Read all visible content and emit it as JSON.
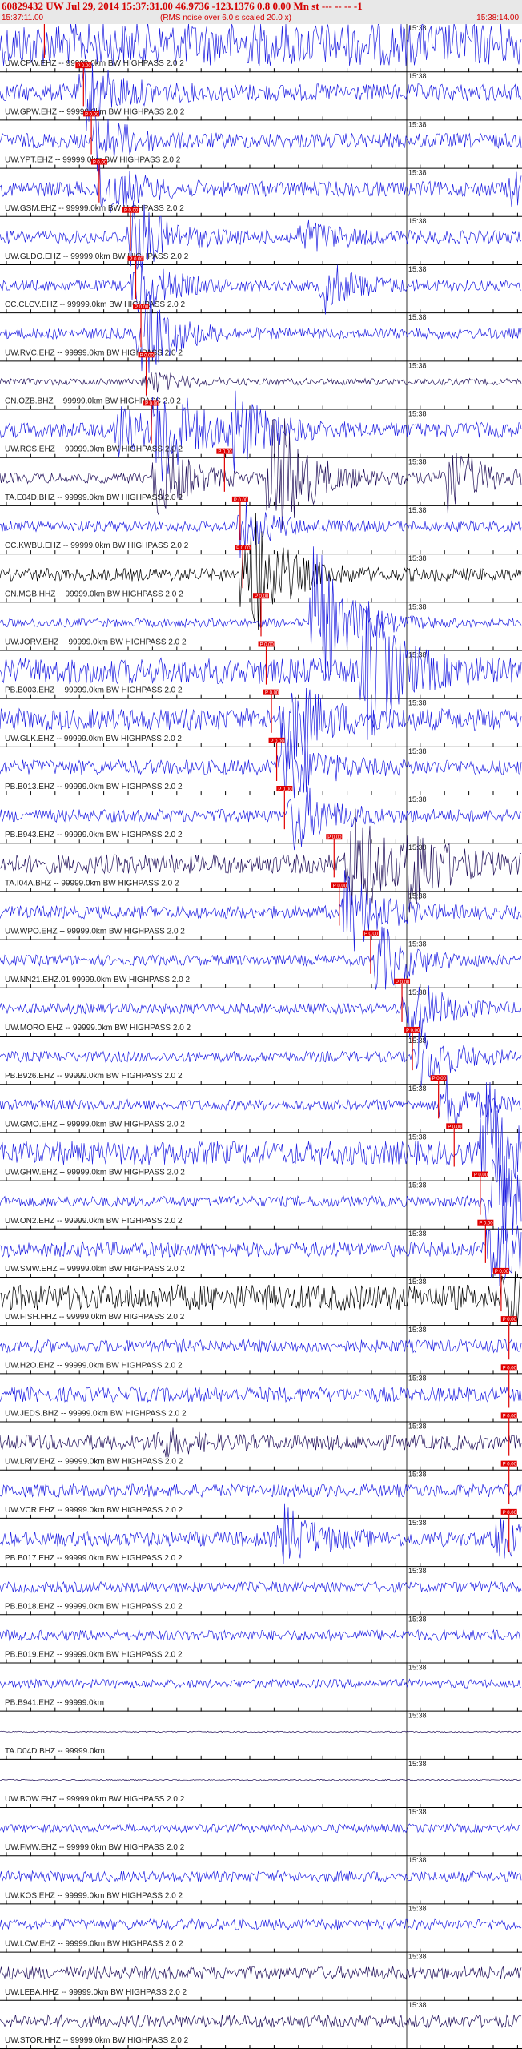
{
  "header": {
    "title": "60829432 UW Jul 29, 2014 15:37:31.00   46.9736 -123.1376  0.8 0.00 Mn st --- -- --  -1",
    "start_time": "15:37:11.00",
    "rms_note": "(RMS noise over 6.0 s scaled 20.0 x)",
    "end_time": "15:38:14.00"
  },
  "time_marker_label": "15:38",
  "pick_label": "P 0.00",
  "colors": {
    "trace_blue": "#1f1fe0",
    "trace_dark": "#22115a",
    "trace_black": "#000000",
    "pick_red": "#e00000",
    "header_red": "#d40000"
  },
  "traces": [
    {
      "label": "UW.CPW.EHZ -- 99999.0km BW  HIGHPASS  2.0  2",
      "color": "blue",
      "pick": 0.085,
      "amp": 1.0,
      "bursts": []
    },
    {
      "label": "UW.GPW.EHZ -- 99999.0km BW  HIGHPASS  2.0  2",
      "color": "blue",
      "pick": 0.16,
      "amp": 0.4,
      "bursts": [
        [
          0.16,
          1.6
        ]
      ]
    },
    {
      "label": "UW.YPT.EHZ -- 99999.0km BW  HIGHPASS  2.0  2",
      "color": "blue",
      "pick": 0.175,
      "amp": 0.35,
      "bursts": [
        [
          0.18,
          1.3
        ]
      ]
    },
    {
      "label": "UW.GSM.EHZ -- 99999.0km BW  HIGHPASS  2.0  2",
      "color": "blue",
      "pick": 0.19,
      "amp": 0.35,
      "bursts": [
        [
          0.19,
          1.5
        ],
        [
          0.98,
          0.6
        ]
      ]
    },
    {
      "label": "UW.GLDO.EHZ -- 99999.0km BW  HIGHPASS  2.0  2",
      "color": "blue",
      "pick": 0.25,
      "amp": 0.3,
      "bursts": [
        [
          0.25,
          2.0
        ],
        [
          0.58,
          0.8
        ]
      ]
    },
    {
      "label": "CC.CLCV.EHZ -- 99999.0km BW  HIGHPASS  2.0  2",
      "color": "blue",
      "pick": 0.26,
      "amp": 0.25,
      "bursts": [
        [
          0.26,
          1.5
        ],
        [
          0.62,
          1.2
        ]
      ]
    },
    {
      "label": "UW.RVC.EHZ -- 99999.0km BW  HIGHPASS  2.0  2",
      "color": "blue",
      "pick": 0.27,
      "amp": 0.25,
      "bursts": [
        [
          0.27,
          2.2
        ]
      ]
    },
    {
      "label": "CN.OZB.BHZ -- 99999.0km BW  HIGHPASS  2.0  2",
      "color": "dark",
      "pick": 0.28,
      "amp": 0.15,
      "bursts": [
        [
          0.28,
          0.6
        ]
      ]
    },
    {
      "label": "UW.RCS.EHZ -- 99999.0km BW  HIGHPASS  2.0  2",
      "color": "blue",
      "pick": 0.29,
      "amp": 0.35,
      "bursts": [
        [
          0.3,
          3.2
        ],
        [
          0.44,
          1.8
        ],
        [
          0.22,
          1.2
        ]
      ]
    },
    {
      "label": "TA.E04D.BHZ -- 99999.0km BW  HIGHPASS  2.0  2",
      "color": "dark",
      "pick": 0.43,
      "amp": 0.25,
      "bursts": [
        [
          0.3,
          2.0
        ],
        [
          0.52,
          4.0
        ],
        [
          0.85,
          2.0
        ]
      ]
    },
    {
      "label": "CC.KWBU.EHZ -- 99999.0km BW  HIGHPASS  2.0  2",
      "color": "blue",
      "pick": 0.46,
      "amp": 0.25,
      "bursts": [
        [
          0.46,
          1.2
        ]
      ]
    },
    {
      "label": "CN.MGB.HHZ -- 99999.0km BW  HIGHPASS  2.0  2",
      "color": "black",
      "pick": 0.465,
      "amp": 0.3,
      "bursts": [
        [
          0.47,
          4.0
        ]
      ]
    },
    {
      "label": "UW.JORV.EHZ -- 99999.0km BW  HIGHPASS  2.0  2",
      "color": "blue",
      "pick": 0.5,
      "amp": 0.2,
      "bursts": [
        [
          0.6,
          4.0
        ]
      ]
    },
    {
      "label": "PB.B003.EHZ -- 99999.0km BW  HIGHPASS  2.0  2",
      "color": "blue",
      "pick": 0.51,
      "amp": 0.6,
      "bursts": [
        [
          0.7,
          3.5
        ]
      ]
    },
    {
      "label": "UW.GLK.EHZ -- 99999.0km BW  HIGHPASS  2.0  2",
      "color": "blue",
      "pick": 0.52,
      "amp": 0.5,
      "bursts": [
        [
          0.54,
          2.5
        ]
      ]
    },
    {
      "label": "PB.B013.EHZ -- 99999.0km BW  HIGHPASS  2.0  2",
      "color": "blue",
      "pick": 0.53,
      "amp": 0.35,
      "bursts": [
        [
          0.54,
          2.0
        ]
      ]
    },
    {
      "label": "PB.B943.EHZ -- 99999.0km BW  HIGHPASS  2.0  2",
      "color": "blue",
      "pick": 0.545,
      "amp": 0.3,
      "bursts": [
        [
          0.56,
          1.8
        ]
      ]
    },
    {
      "label": "TA.I04A.BHZ -- 99999.0km BW  HIGHPASS  2.0  2",
      "color": "dark",
      "pick": 0.64,
      "amp": 0.45,
      "bursts": [
        [
          0.67,
          3.0
        ],
        [
          0.78,
          2.0
        ]
      ]
    },
    {
      "label": "UW.WPO.EHZ -- 99999.0km BW  HIGHPASS  2.0  2",
      "color": "blue",
      "pick": 0.65,
      "amp": 0.3,
      "bursts": [
        [
          0.66,
          2.2
        ]
      ]
    },
    {
      "label": "UW.NN21.EHZ.01 99999.0km BW  HIGHPASS  2.0  2",
      "color": "blue",
      "pick": 0.71,
      "amp": 0.25,
      "bursts": [
        [
          0.72,
          1.8
        ]
      ]
    },
    {
      "label": "UW.MORO.EHZ -- 99999.0km BW  HIGHPASS  2.0  2",
      "color": "blue",
      "pick": 0.77,
      "amp": 0.25,
      "bursts": [
        [
          0.78,
          1.8
        ]
      ]
    },
    {
      "label": "PB.B926.EHZ -- 99999.0km BW  HIGHPASS  2.0  2",
      "color": "blue",
      "pick": 0.79,
      "amp": 0.25,
      "bursts": [
        [
          0.8,
          1.6
        ]
      ]
    },
    {
      "label": "UW.GMO.EHZ -- 99999.0km BW  HIGHPASS  2.0  2",
      "color": "blue",
      "pick": 0.84,
      "amp": 0.25,
      "bursts": [
        [
          0.85,
          1.4
        ]
      ]
    },
    {
      "label": "UW.GHW.EHZ -- 99999.0km BW  HIGHPASS  2.0  2",
      "color": "blue",
      "pick": 0.87,
      "amp": 0.55,
      "bursts": [
        [
          0.93,
          3.5
        ]
      ]
    },
    {
      "label": "UW.ON2.EHZ -- 99999.0km BW  HIGHPASS  2.0  2",
      "color": "blue",
      "pick": 0.92,
      "amp": 0.25,
      "bursts": [
        [
          0.94,
          3.0
        ]
      ]
    },
    {
      "label": "UW.SMW.EHZ -- 99999.0km BW  HIGHPASS  2.0  2",
      "color": "blue",
      "pick": 0.93,
      "amp": 0.35,
      "bursts": [
        [
          0.94,
          2.0
        ]
      ]
    },
    {
      "label": "UW.FISH.HHZ -- 99999.0km BW  HIGHPASS  2.0  2",
      "color": "black",
      "pick": 0.96,
      "amp": 0.6,
      "bursts": [
        [
          0.97,
          1.6
        ]
      ]
    },
    {
      "label": "UW.H2O.EHZ -- 99999.0km BW  HIGHPASS  2.0  2",
      "color": "blue",
      "pick": 0.975,
      "amp": 0.3,
      "bursts": []
    },
    {
      "label": "UW.JEDS.BHZ -- 99999.0km BW  HIGHPASS  2.0  2",
      "color": "blue",
      "pick": 0.975,
      "amp": 0.35,
      "bursts": []
    },
    {
      "label": "UW.LRIV.EHZ -- 99999.0km BW  HIGHPASS  2.0  2",
      "color": "dark",
      "pick": 0.975,
      "amp": 0.35,
      "bursts": [
        [
          0.3,
          0.6
        ]
      ]
    },
    {
      "label": "UW.VCR.EHZ -- 99999.0km BW  HIGHPASS  2.0  2",
      "color": "blue",
      "pick": 0.975,
      "amp": 0.3,
      "bursts": []
    },
    {
      "label": "PB.B017.EHZ -- 99999.0km BW  HIGHPASS  2.0  2",
      "color": "blue",
      "pick": 0.975,
      "amp": 0.35,
      "bursts": [
        [
          0.54,
          1.5
        ],
        [
          0.95,
          0.8
        ]
      ]
    },
    {
      "label": "PB.B018.EHZ -- 99999.0km BW  HIGHPASS  2.0  2",
      "color": "blue",
      "pick": null,
      "amp": 0.25,
      "bursts": []
    },
    {
      "label": "PB.B019.EHZ -- 99999.0km BW  HIGHPASS  2.0  2",
      "color": "blue",
      "pick": null,
      "amp": 0.25,
      "bursts": []
    },
    {
      "label": "PB.B941.EHZ -- 99999.0km",
      "color": "blue",
      "pick": null,
      "amp": 0.2,
      "bursts": []
    },
    {
      "label": "TA.D04D.BHZ -- 99999.0km",
      "color": "dark",
      "pick": null,
      "amp": 0.03,
      "bursts": []
    },
    {
      "label": "UW.BOW.EHZ -- 99999.0km BW  HIGHPASS  2.0  2",
      "color": "dark",
      "pick": null,
      "amp": 0.03,
      "bursts": []
    },
    {
      "label": "UW.FMW.EHZ -- 99999.0km BW  HIGHPASS  2.0  2",
      "color": "blue",
      "pick": null,
      "amp": 0.2,
      "bursts": []
    },
    {
      "label": "UW.KOS.EHZ -- 99999.0km BW  HIGHPASS  2.0  2",
      "color": "blue",
      "pick": null,
      "amp": 0.25,
      "bursts": []
    },
    {
      "label": "UW.LCW.EHZ -- 99999.0km BW  HIGHPASS  2.0  2",
      "color": "blue",
      "pick": null,
      "amp": 0.25,
      "bursts": []
    },
    {
      "label": "UW.LEBA.HHZ -- 99999.0km BW  HIGHPASS  2.0  2",
      "color": "dark",
      "pick": null,
      "amp": 0.3,
      "bursts": []
    },
    {
      "label": "UW.STOR.HHZ -- 99999.0km BW  HIGHPASS  2.0  2",
      "color": "dark",
      "pick": null,
      "amp": 0.3,
      "bursts": []
    }
  ]
}
